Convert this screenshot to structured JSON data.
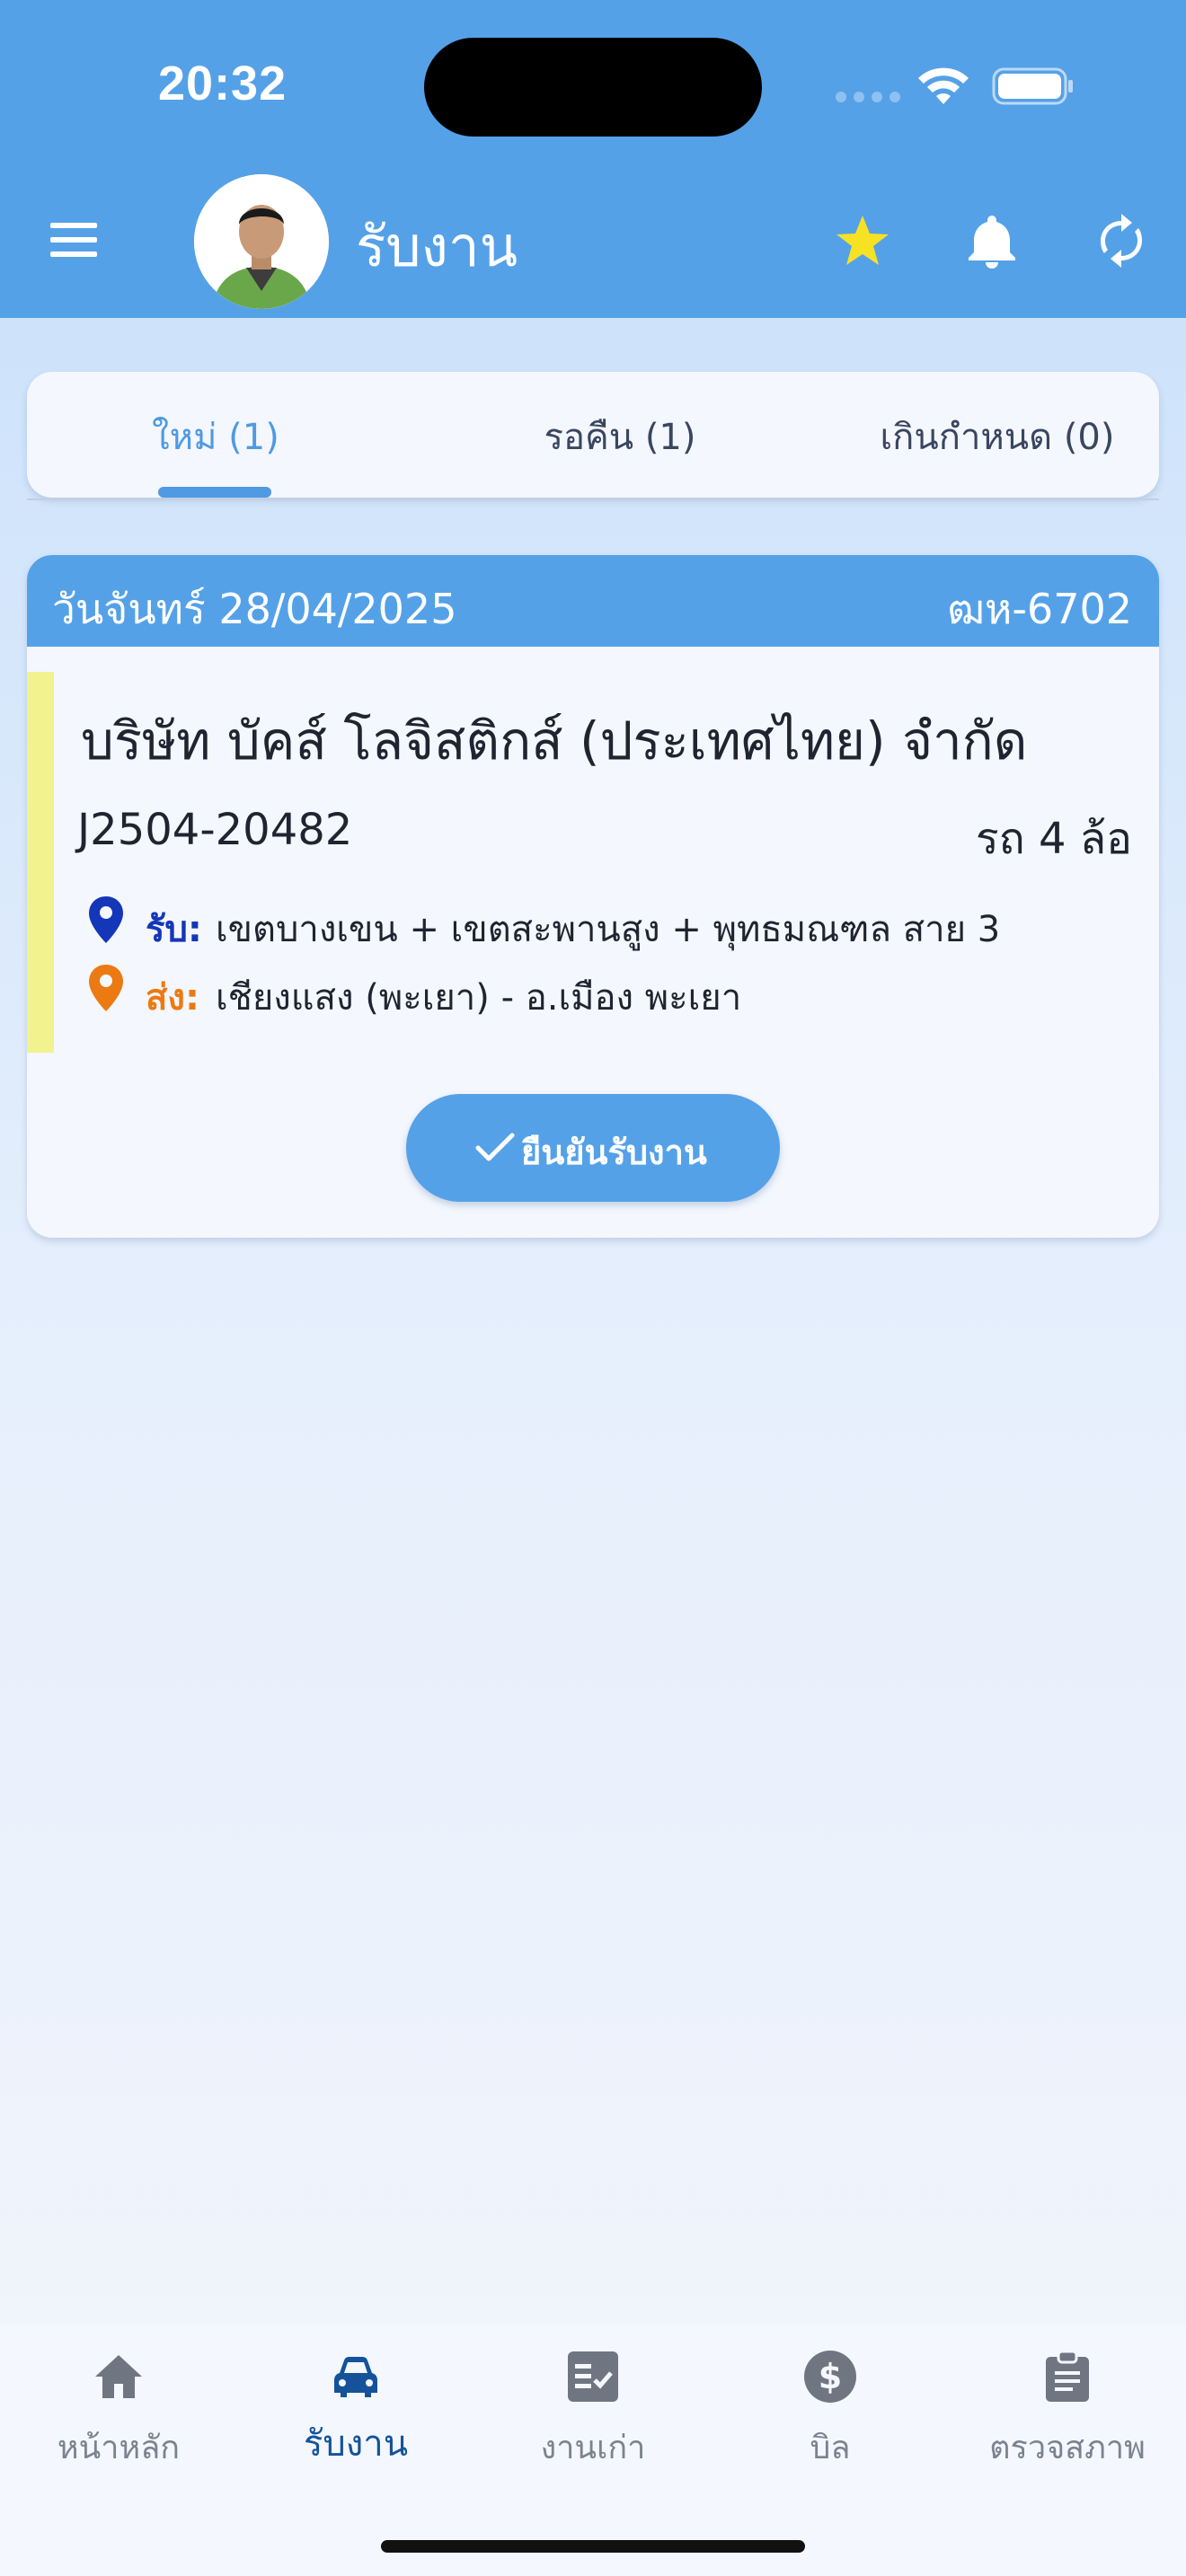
{
  "status_bar": {
    "time": "20:32"
  },
  "header": {
    "title": "รับงาน",
    "accent_color": "#55a1e8",
    "icons": [
      "menu-icon",
      "star-icon",
      "bell-icon",
      "refresh-icon"
    ]
  },
  "tabs": [
    {
      "label": "ใหม่ (1)",
      "active": true
    },
    {
      "label": "รอคืน (1)",
      "active": false
    },
    {
      "label": "เกินกำหนด (0)",
      "active": false
    }
  ],
  "job": {
    "date": "วันจันทร์ 28/04/2025",
    "plate": "ฒห-6702",
    "company": "บริษัท บัคส์ โลจิสติกส์ (ประเทศไทย) จำกัด",
    "code": "J2504-20482",
    "vehicle": "รถ 4 ล้อ",
    "pickup_label": "รับ:",
    "pickup_value": "เขตบางเขน + เขตสะพานสูง + พุทธมณฑล สาย 3",
    "dropoff_label": "ส่ง:",
    "dropoff_value": "เชียงแสง (พะเยา) - อ.เมือง พะเยา",
    "confirm_label": "ยืนยันรับงาน",
    "pickup_color": "#1436b8",
    "dropoff_color": "#ec7a12",
    "accent_bar_color": "#f2f28e"
  },
  "bottom_nav": [
    {
      "label": "หน้าหลัก",
      "icon": "home-icon",
      "active": false
    },
    {
      "label": "รับงาน",
      "icon": "car-icon",
      "active": true
    },
    {
      "label": "งานเก่า",
      "icon": "checklist-icon",
      "active": false
    },
    {
      "label": "บิล",
      "icon": "dollar-icon",
      "active": false
    },
    {
      "label": "ตรวจสภาพ",
      "icon": "clipboard-icon",
      "active": false
    }
  ]
}
